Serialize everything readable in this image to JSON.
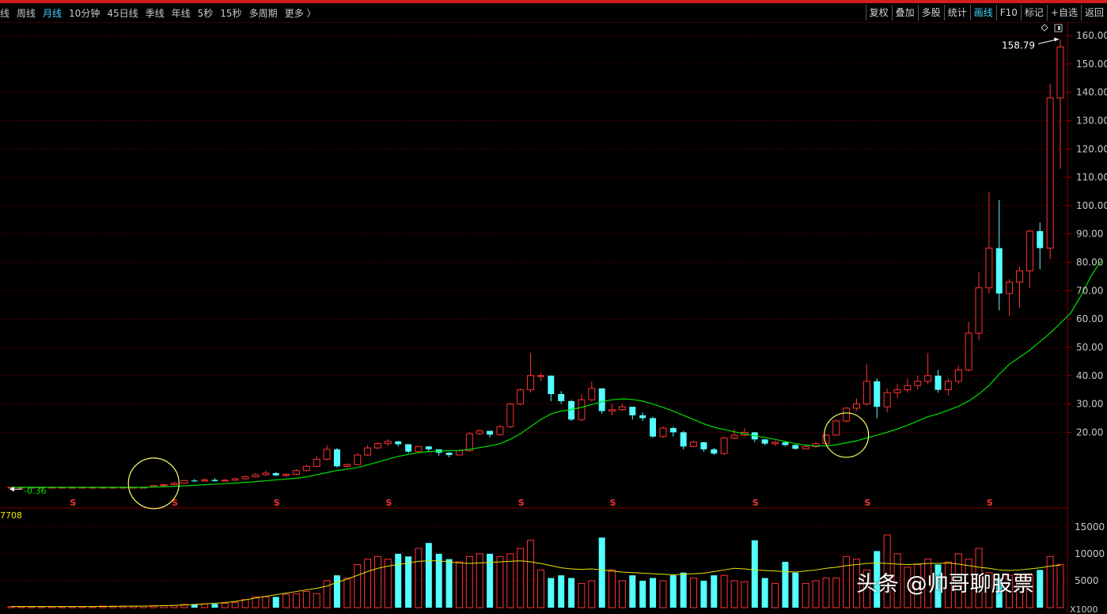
{
  "toolbar": {
    "periods": [
      "线",
      "周线",
      "月线",
      "10分钟",
      "45日线",
      "季线",
      "年线",
      "5秒",
      "15秒",
      "多周期",
      "更多 〉"
    ],
    "active_period": "月线",
    "actions": [
      "复权",
      "叠加",
      "多股",
      "统计",
      "画线",
      "F10",
      "标记",
      "+自选",
      "返回"
    ],
    "active_action": "画线"
  },
  "price_axis_labels": [
    "160.00",
    "150.00",
    "140.00",
    "130.00",
    "120.00",
    "110.00",
    "100.00",
    "90.00",
    "80.00",
    "70.00",
    "60.00",
    "50.00",
    "40.00",
    "30.00",
    "20.00"
  ],
  "volume_axis_labels": [
    "15000",
    "10000",
    "5000"
  ],
  "volume_axis_unit": "X1000",
  "volume_readout": "7708",
  "annotations": {
    "max_price": "158.79",
    "min_price": "0.36",
    "dividend_marker": "S"
  },
  "watermark": "头条 @帅哥聊股票",
  "colors": {
    "up": "#ff3232",
    "down": "#54ffff",
    "ma_price": "#00e000",
    "ma_volume": "#e6e600",
    "grid": "#5a0000",
    "circle": "#ffff66"
  },
  "chart_data": {
    "type": "candlestick",
    "period": "monthly",
    "price_ylim": [
      0,
      160
    ],
    "volume_ylim": [
      0,
      16000
    ],
    "candles": [
      [
        0.6,
        0.6,
        0.8,
        0.5
      ],
      [
        0.6,
        0.6,
        0.8,
        0.5
      ],
      [
        0.6,
        0.6,
        0.8,
        0.5
      ],
      [
        0.6,
        0.6,
        0.8,
        0.5
      ],
      [
        0.6,
        0.6,
        0.8,
        0.5
      ],
      [
        0.6,
        0.6,
        0.8,
        0.5
      ],
      [
        0.6,
        0.6,
        0.8,
        0.5
      ],
      [
        0.6,
        0.6,
        0.8,
        0.5
      ],
      [
        0.6,
        0.6,
        0.8,
        0.5
      ],
      [
        0.6,
        0.6,
        0.8,
        0.5
      ],
      [
        0.6,
        0.6,
        0.8,
        0.5
      ],
      [
        0.6,
        0.6,
        0.8,
        0.5
      ],
      [
        0.6,
        0.6,
        0.8,
        0.5
      ],
      [
        0.6,
        0.6,
        0.8,
        0.5
      ],
      [
        0.8,
        1.2,
        1.5,
        0.7
      ],
      [
        1.2,
        1.5,
        1.8,
        1.0
      ],
      [
        1.5,
        2.0,
        2.5,
        1.3
      ],
      [
        2.0,
        3.0,
        3.2,
        1.9
      ],
      [
        3.0,
        2.8,
        3.5,
        2.5
      ],
      [
        2.8,
        3.2,
        3.6,
        2.6
      ],
      [
        3.2,
        2.8,
        3.8,
        2.6
      ],
      [
        2.8,
        3.1,
        3.5,
        2.6
      ],
      [
        3.1,
        3.6,
        4.0,
        3.0
      ],
      [
        3.6,
        4.3,
        4.8,
        3.4
      ],
      [
        4.3,
        5.0,
        5.6,
        4.0
      ],
      [
        5.0,
        5.6,
        6.5,
        4.8
      ],
      [
        5.6,
        4.8,
        6.0,
        4.5
      ],
      [
        4.8,
        5.2,
        5.5,
        4.2
      ],
      [
        5.2,
        6.5,
        7.0,
        5.0
      ],
      [
        6.5,
        8.0,
        8.5,
        6.2
      ],
      [
        8.0,
        10.5,
        11.5,
        7.8
      ],
      [
        10.5,
        14.0,
        15.5,
        10.0
      ],
      [
        14.0,
        8.0,
        14.5,
        7.6
      ],
      [
        8.0,
        8.6,
        9.0,
        7.5
      ],
      [
        8.6,
        12.0,
        12.5,
        8.3
      ],
      [
        12.0,
        14.5,
        15.5,
        11.5
      ],
      [
        14.5,
        16.0,
        16.5,
        14.0
      ],
      [
        16.0,
        16.8,
        17.5,
        15.2
      ],
      [
        16.8,
        15.8,
        17.0,
        15.0
      ],
      [
        15.8,
        13.2,
        15.8,
        12.6
      ],
      [
        13.2,
        15.0,
        15.2,
        12.8
      ],
      [
        15.0,
        14.0,
        15.2,
        13.0
      ],
      [
        14.0,
        12.8,
        13.8,
        11.8
      ],
      [
        12.8,
        12.0,
        13.0,
        11.2
      ],
      [
        12.0,
        13.5,
        14.0,
        11.8
      ],
      [
        13.5,
        19.5,
        20.0,
        13.2
      ],
      [
        19.5,
        20.5,
        21.0,
        19.0
      ],
      [
        20.5,
        19.2,
        20.0,
        18.2
      ],
      [
        19.2,
        22.0,
        22.5,
        18.8
      ],
      [
        22.0,
        30.0,
        30.5,
        21.5
      ],
      [
        30.0,
        35.0,
        35.5,
        29.5
      ],
      [
        35.0,
        40.0,
        48.0,
        34.0
      ],
      [
        40.0,
        40.0,
        41.0,
        38.0
      ],
      [
        40.0,
        33.5,
        40.0,
        31.0
      ],
      [
        33.5,
        31.0,
        34.5,
        30.0
      ],
      [
        31.0,
        24.5,
        31.5,
        24.0
      ],
      [
        24.5,
        31.5,
        33.5,
        24.0
      ],
      [
        31.5,
        35.5,
        38.0,
        31.0
      ],
      [
        35.5,
        27.5,
        35.5,
        26.5
      ],
      [
        27.5,
        28.0,
        30.0,
        26.0
      ],
      [
        28.0,
        29.0,
        30.0,
        27.5
      ],
      [
        29.0,
        26.0,
        29.0,
        24.5
      ],
      [
        26.0,
        25.0,
        27.0,
        24.0
      ],
      [
        25.0,
        18.5,
        25.5,
        18.0
      ],
      [
        18.5,
        21.5,
        22.0,
        18.0
      ],
      [
        21.5,
        20.0,
        22.0,
        18.5
      ],
      [
        20.0,
        15.0,
        20.5,
        14.0
      ],
      [
        15.0,
        16.5,
        17.0,
        14.8
      ],
      [
        16.5,
        14.0,
        16.6,
        13.2
      ],
      [
        14.0,
        12.5,
        14.5,
        12.0
      ],
      [
        12.5,
        18.0,
        18.5,
        12.0
      ],
      [
        18.0,
        19.0,
        21.0,
        17.5
      ],
      [
        19.0,
        20.0,
        21.5,
        18.5
      ],
      [
        20.0,
        17.5,
        20.0,
        16.5
      ],
      [
        17.5,
        16.0,
        17.5,
        15.5
      ],
      [
        16.0,
        16.5,
        17.0,
        15.2
      ],
      [
        16.5,
        15.5,
        16.8,
        15.0
      ],
      [
        15.5,
        14.2,
        15.8,
        13.8
      ],
      [
        14.2,
        15.0,
        15.5,
        14.0
      ],
      [
        15.0,
        16.0,
        16.5,
        14.5
      ],
      [
        16.0,
        19.0,
        19.5,
        15.8
      ],
      [
        19.0,
        24.0,
        24.5,
        18.8
      ],
      [
        24.0,
        28.5,
        29.0,
        23.5
      ],
      [
        28.5,
        30.0,
        32.0,
        27.5
      ],
      [
        30.0,
        38.0,
        44.0,
        29.5
      ],
      [
        38.0,
        29.0,
        39.0,
        25.0
      ],
      [
        29.0,
        34.0,
        35.5,
        27.0
      ],
      [
        34.0,
        35.0,
        37.0,
        32.0
      ],
      [
        35.0,
        36.5,
        39.0,
        34.0
      ],
      [
        36.5,
        38.0,
        40.0,
        35.0
      ],
      [
        38.0,
        40.0,
        48.0,
        37.0
      ],
      [
        40.0,
        35.0,
        42.0,
        34.0
      ],
      [
        35.0,
        38.0,
        39.0,
        33.0
      ],
      [
        38.0,
        42.0,
        43.5,
        37.0
      ],
      [
        42.0,
        55.0,
        59.0,
        41.5
      ],
      [
        55.0,
        71.0,
        76.5,
        52.5
      ],
      [
        71.0,
        85.0,
        105.0,
        69.0
      ],
      [
        85.0,
        69.0,
        102.0,
        63.0
      ],
      [
        69.0,
        73.0,
        74.0,
        61.0
      ],
      [
        73.0,
        77.0,
        78.5,
        64.0
      ],
      [
        77.0,
        91.0,
        91.5,
        71.0
      ],
      [
        91.0,
        85.0,
        94.0,
        77.5
      ],
      [
        85.0,
        138.0,
        143.0,
        81.0
      ],
      [
        138.0,
        156.0,
        158.79,
        113.0
      ]
    ],
    "ma": [
      0.6,
      0.6,
      0.6,
      0.6,
      0.6,
      0.6,
      0.6,
      0.6,
      0.6,
      0.6,
      0.6,
      0.6,
      0.6,
      0.6,
      0.7,
      0.8,
      0.9,
      1.1,
      1.3,
      1.5,
      1.7,
      1.9,
      2.1,
      2.3,
      2.6,
      2.9,
      3.2,
      3.5,
      3.8,
      4.3,
      5.0,
      5.8,
      6.5,
      7.0,
      7.6,
      8.5,
      9.5,
      10.5,
      11.5,
      12.2,
      12.8,
      13.2,
      13.4,
      13.5,
      13.6,
      14.0,
      14.6,
      15.2,
      16.0,
      17.5,
      19.5,
      22.0,
      24.5,
      26.5,
      27.5,
      28.0,
      28.8,
      29.8,
      30.8,
      31.5,
      31.8,
      31.6,
      31.0,
      30.0,
      28.8,
      27.5,
      26.0,
      24.5,
      23.0,
      21.8,
      21.0,
      20.2,
      19.5,
      18.8,
      18.2,
      17.5,
      16.8,
      16.0,
      15.5,
      15.2,
      15.2,
      15.6,
      16.3,
      17.0,
      18.0,
      19.0,
      20.0,
      21.2,
      22.5,
      24.0,
      25.5,
      26.5,
      27.8,
      29.2,
      31.0,
      33.5,
      36.5,
      40.5,
      44.0,
      46.5,
      49.0,
      52.0,
      55.0,
      58.5,
      62.0,
      68.0,
      75.0,
      80.5
    ],
    "volume": [
      200,
      200,
      200,
      200,
      200,
      200,
      200,
      200,
      200,
      300,
      300,
      300,
      300,
      300,
      400,
      400,
      400,
      600,
      600,
      700,
      700,
      800,
      1000,
      1500,
      2000,
      2000,
      2000,
      2500,
      2600,
      3000,
      2600,
      5000,
      6000,
      5500,
      8000,
      9000,
      9500,
      9000,
      10000,
      9500,
      11000,
      12000,
      10000,
      9000,
      8500,
      9500,
      10000,
      10000,
      9500,
      10000,
      11000,
      12500,
      7000,
      5500,
      6000,
      5500,
      4500,
      5000,
      13000,
      7000,
      5000,
      6000,
      5000,
      5500,
      5000,
      6000,
      6500,
      5500,
      5000,
      6000,
      6000,
      5000,
      4800,
      12500,
      5500,
      4500,
      8500,
      6500,
      4500,
      5000,
      5500,
      5500,
      9500,
      9000,
      7000,
      10500,
      13500,
      10000,
      7500,
      8000,
      9000,
      8000,
      8500,
      10000,
      9000,
      11000,
      6500,
      5500,
      6000,
      6000,
      6000,
      7000,
      9500,
      8000
    ],
    "volume_ma": [
      200,
      200,
      200,
      200,
      200,
      200,
      200,
      200,
      200,
      220,
      240,
      260,
      280,
      300,
      320,
      360,
      420,
      500,
      600,
      700,
      800,
      950,
      1150,
      1450,
      1800,
      2100,
      2400,
      2700,
      3000,
      3300,
      3600,
      4000,
      4700,
      5300,
      6000,
      6700,
      7300,
      7700,
      8000,
      8300,
      8600,
      8700,
      8700,
      8500,
      8300,
      8200,
      8300,
      8400,
      8500,
      8600,
      8700,
      8500,
      8200,
      7800,
      7400,
      7200,
      7100,
      7200,
      7000,
      6800,
      6600,
      6500,
      6400,
      6300,
      6200,
      6100,
      6200,
      6300,
      6400,
      6700,
      7000,
      7300,
      7200,
      7000,
      6900,
      6800,
      6700,
      6600,
      6800,
      7000,
      7300,
      7500,
      7800,
      8000,
      8200,
      8300,
      8200,
      8100,
      8000,
      8100,
      8200,
      8200,
      8300,
      8100,
      7800,
      7500,
      7300,
      7000,
      6900,
      7000,
      7200,
      7400,
      7700,
      7900
    ]
  }
}
